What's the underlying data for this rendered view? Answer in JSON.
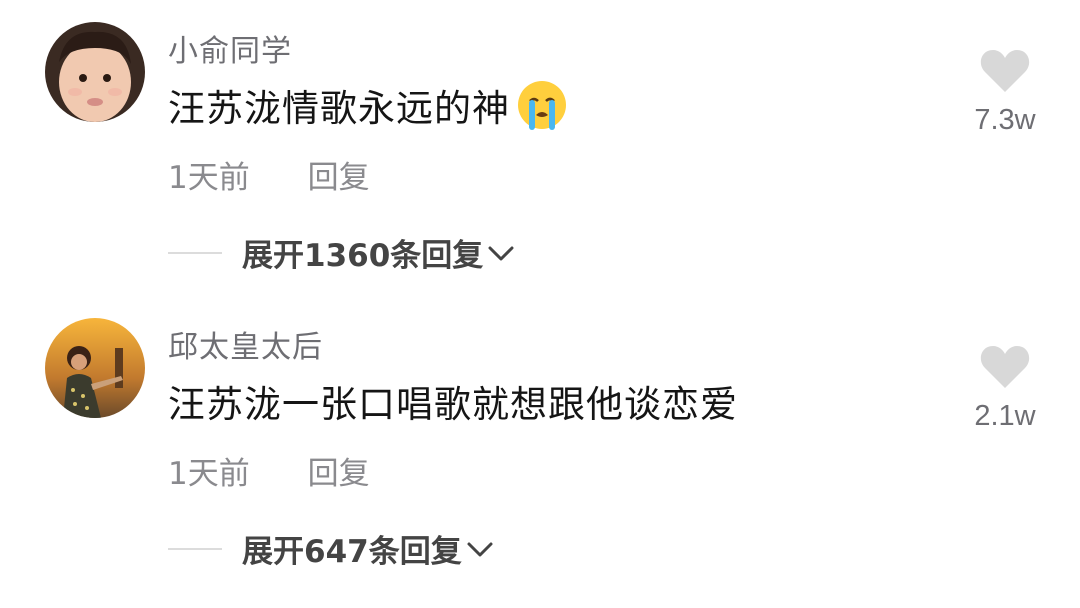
{
  "comments": [
    {
      "username": "小俞同学",
      "text": "汪苏泷情歌永远的神",
      "emoji": "loudly-crying-face",
      "time": "1天前",
      "reply_label": "回复",
      "likes": "7.3w",
      "expand_label": "展开1360条回复"
    },
    {
      "username": "邱太皇太后",
      "text": "汪苏泷一张口唱歌就想跟他谈恋爱",
      "time": "1天前",
      "reply_label": "回复",
      "likes": "2.1w",
      "expand_label": "展开647条回复"
    }
  ],
  "colors": {
    "username": "#6e6e73",
    "text": "#151515",
    "meta": "#8a8a8e",
    "heart": "#d8d8d8"
  }
}
